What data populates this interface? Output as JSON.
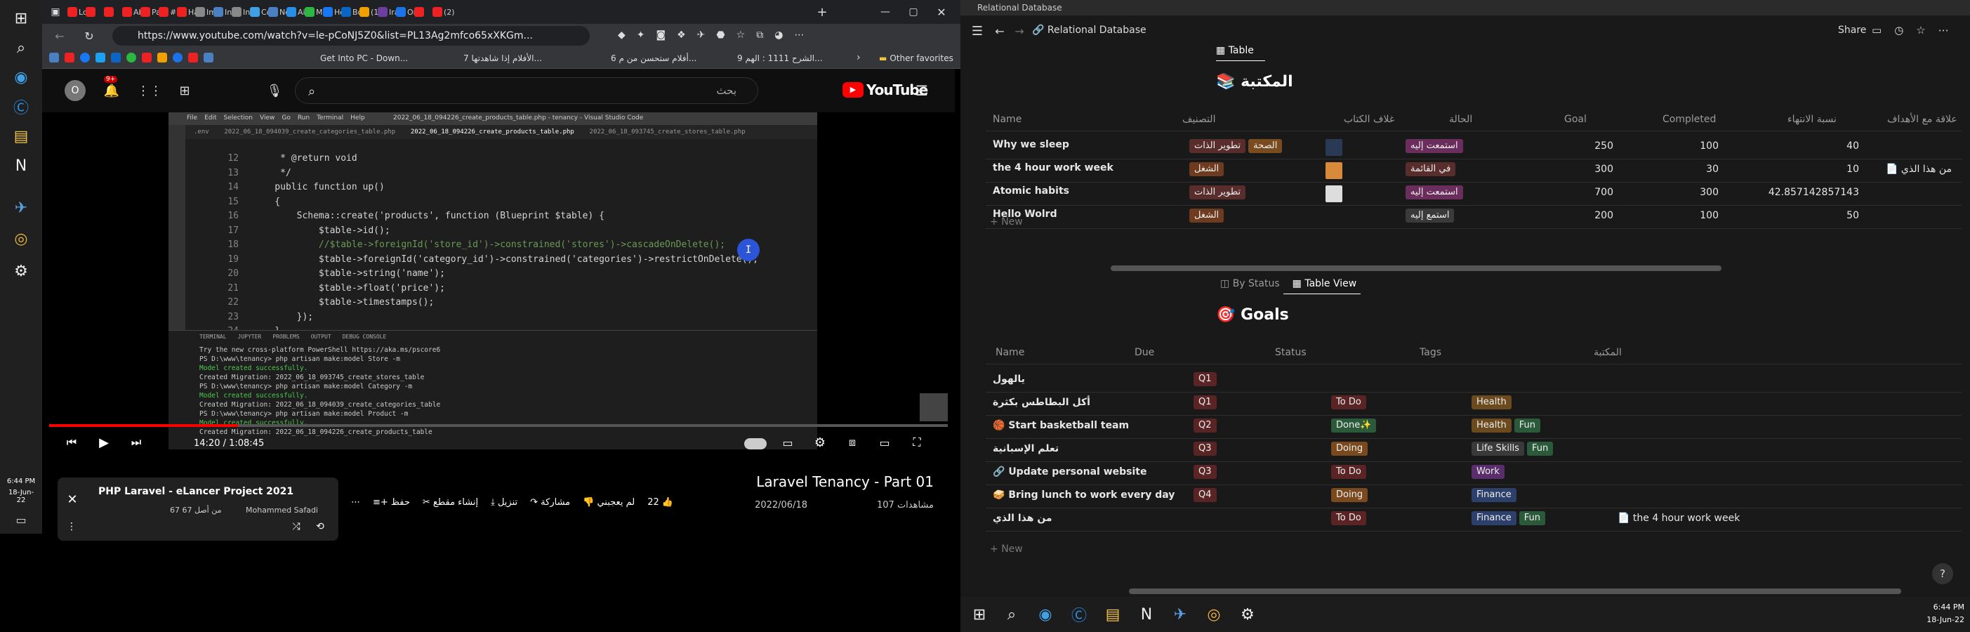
{
  "left_taskbar": {
    "time": "6:44 PM",
    "date": "18-Jun-22",
    "icons": [
      "windows-icon",
      "search-icon",
      "edge-icon",
      "cortana-icon",
      "file-explorer-icon",
      "notion-icon",
      "teams-icon",
      "chrome-icon",
      "settings-icon"
    ]
  },
  "browser": {
    "url": "https://www.youtube.com/watch?v=le-pCoNJ5Z0&list=PL13Ag2mfco65xXKGm...",
    "tabs": [
      "Lo",
      "",
      "",
      " Ab",
      "Pa",
      "#0",
      "Ha",
      "Im",
      "Ins",
      "Ins",
      "Co",
      "Nc",
      "Ai",
      "Mi",
      "Ho",
      "Bo",
      "(1)",
      "Ira",
      "Or",
      "",
      "(2)"
    ],
    "bookmarks": [
      "Get Into PC - Down...",
      "7 الأفلام إذا شاهدتها...",
      "6 أفلام ستحسن من م...",
      "الشرح 1111 : الهم 9...",
      "Other favorites"
    ]
  },
  "youtube": {
    "logo_text": "YouTube",
    "notification_count": "9+",
    "avatar_letter": "O",
    "search_placeholder": "بحث",
    "vscode_title": "2022_06_18_094226_create_products_table.php - tenancy - Visual Studio Code",
    "vscode_menu": [
      "File",
      "Edit",
      "Selection",
      "View",
      "Go",
      "Run",
      "Terminal",
      "Help"
    ],
    "code_lines": [
      {
        "n": "12",
        "t": "     * @return void"
      },
      {
        "n": "13",
        "t": "     */"
      },
      {
        "n": "14",
        "t": "    public function up()"
      },
      {
        "n": "15",
        "t": "    {"
      },
      {
        "n": "16",
        "t": "        Schema::create('products', function (Blueprint $table) {"
      },
      {
        "n": "17",
        "t": "            $table->id();"
      },
      {
        "n": "18",
        "t": "            //$table->foreignId('store_id')->constrained('stores')->cascadeOnDelete();"
      },
      {
        "n": "19",
        "t": "            $table->foreignId('category_id')->constrained('categories')->restrictOnDelete();"
      },
      {
        "n": "20",
        "t": "            $table->string('name');"
      },
      {
        "n": "21",
        "t": "            $table->float('price');"
      },
      {
        "n": "22",
        "t": "            $table->timestamps();"
      },
      {
        "n": "23",
        "t": "        });"
      },
      {
        "n": "24",
        "t": "    }"
      }
    ],
    "terminal_tabs": [
      "TERMINAL",
      "JUPYTER",
      "PROBLEMS",
      "OUTPUT",
      "DEBUG CONSOLE"
    ],
    "terminal_lines": [
      "Try the new cross-platform PowerShell https://aka.ms/pscore6",
      "PS D:\\www\\tenancy> php artisan make:model Store -m",
      "Model created successfully.",
      "Created Migration: 2022_06_18_093745_create_stores_table",
      "PS D:\\www\\tenancy> php artisan make:model Category -m",
      "Model created successfully.",
      "Created Migration: 2022_06_18_094039_create_categories_table",
      "PS D:\\www\\tenancy> php artisan make:model Product -m",
      "Model created successfully.",
      "Created Migration: 2022_06_18_094226_create_products_table"
    ],
    "time_display": "14:20 / 1:08:45",
    "progress_fraction": 0.21,
    "video_title": "Laravel Tenancy - Part 01",
    "views": "107 مشاهدات",
    "upload_date": "2022/06/18",
    "likes": "22",
    "dislike_label": "لم يعجبني",
    "share_label": "مشاركة",
    "download_label": "تنزيل",
    "clip_label": "إنشاء مقطع",
    "save_label": "حفظ",
    "playlist_title": "PHP Laravel - eLancer Project 2021",
    "playlist_author": "Mohammed Safadi",
    "playlist_progress": "67 من أصل 67"
  },
  "notion": {
    "window_title": "Relational Database",
    "breadcrumb": "Relational Database",
    "share_label": "Share",
    "view1_tab": "Table",
    "table1_title": "المكتبة",
    "table1_headers": [
      "Name",
      "التصنيف",
      "غلاف الكتاب",
      "الحالة",
      "Goal",
      "Completed",
      "نسبة الانتهاء",
      "علاقة مع الأهداف"
    ],
    "table1_rows": [
      {
        "name": "Why we sleep",
        "cats": [
          {
            "t": "تطوير الذات",
            "c": "#5a2d2d"
          },
          {
            "t": "الصحة",
            "c": "#7a4b1e"
          }
        ],
        "status": {
          "t": "استمعت إليه",
          "c": "#6b2d5c"
        },
        "goal": "250",
        "completed": "100",
        "percent": "40",
        "rel": ""
      },
      {
        "name": "the 4 hour work week",
        "cats": [
          {
            "t": "الشغل",
            "c": "#6e3b1e"
          }
        ],
        "status": {
          "t": "في القائمة",
          "c": "#5a2d2d"
        },
        "goal": "300",
        "completed": "30",
        "percent": "10",
        "rel": "من هذا الذي"
      },
      {
        "name": "Atomic habits",
        "cats": [
          {
            "t": "تطوير الذات",
            "c": "#5a2d2d"
          }
        ],
        "status": {
          "t": "استمعت إليه",
          "c": "#6b2d5c"
        },
        "goal": "700",
        "completed": "300",
        "percent": "42.857142857143",
        "rel": ""
      },
      {
        "name": "Hello Wolrd",
        "cats": [
          {
            "t": "الشغل",
            "c": "#6e3b1e"
          }
        ],
        "status": {
          "t": "استمع إليه",
          "c": "#3a3a3a"
        },
        "goal": "200",
        "completed": "100",
        "percent": "50",
        "rel": ""
      }
    ],
    "new_label": "New",
    "view2_tabs": [
      "By Status",
      "Table View"
    ],
    "table2_title": "Goals",
    "table2_headers": [
      "Name",
      "Due",
      "Status",
      "Tags",
      "المكتبة"
    ],
    "table2_rows": [
      {
        "name": "يالهول",
        "due": "Q1",
        "status": null,
        "tags": [],
        "rel": "",
        "icon": ""
      },
      {
        "name": "أكل البطاطس بكثرة",
        "due": "Q1",
        "status": {
          "t": "To Do",
          "c": "#5a2424"
        },
        "tags": [
          {
            "t": "Health",
            "c": "#6b4a1e"
          }
        ],
        "rel": "",
        "icon": ""
      },
      {
        "name": "Start basketball team",
        "due": "Q2",
        "status": {
          "t": "Done✨",
          "c": "#2b5a3a"
        },
        "tags": [
          {
            "t": "Health",
            "c": "#6b4a1e"
          },
          {
            "t": "Fun",
            "c": "#2b5a3a"
          }
        ],
        "rel": "",
        "icon": "🏀"
      },
      {
        "name": "تعلم الإسبانية",
        "due": "Q3",
        "status": {
          "t": "Doing",
          "c": "#7a4a1e"
        },
        "tags": [
          {
            "t": "Life Skills",
            "c": "#3a3a3a"
          },
          {
            "t": "Fun",
            "c": "#2b5a3a"
          }
        ],
        "rel": "",
        "icon": ""
      },
      {
        "name": "Update personal website",
        "due": "Q3",
        "status": {
          "t": "To Do",
          "c": "#5a2424"
        },
        "tags": [
          {
            "t": "Work",
            "c": "#5a2d6b"
          }
        ],
        "rel": "",
        "icon": "🔗"
      },
      {
        "name": "Bring lunch to work every day",
        "due": "Q4",
        "status": {
          "t": "Doing",
          "c": "#7a4a1e"
        },
        "tags": [
          {
            "t": "Finance",
            "c": "#2d3f6b"
          }
        ],
        "rel": "",
        "icon": "🥪"
      },
      {
        "name": "من هذا الذي",
        "due": "",
        "status": {
          "t": "To Do",
          "c": "#5a2424"
        },
        "tags": [
          {
            "t": "Finance",
            "c": "#2d3f6b"
          },
          {
            "t": "Fun",
            "c": "#2b5a3a"
          }
        ],
        "rel": "the 4 hour work week",
        "icon": ""
      }
    ],
    "due_color": "#5a2424"
  },
  "bottom_taskbar": {
    "time": "6:44 PM",
    "date": "18-Jun-22"
  }
}
